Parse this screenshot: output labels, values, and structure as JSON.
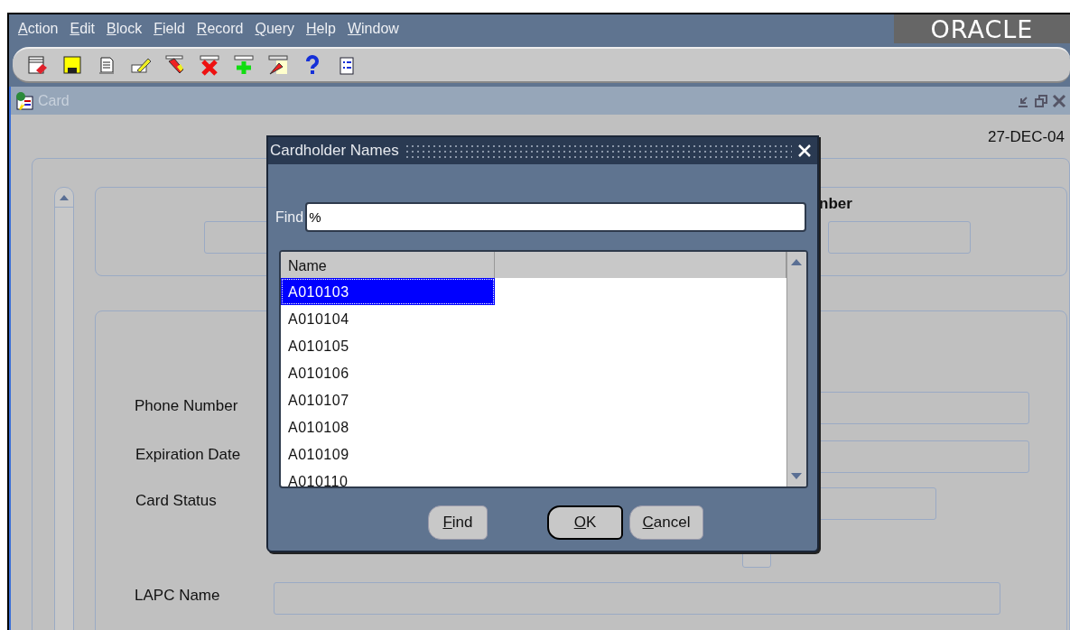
{
  "menu": [
    {
      "label": "Action"
    },
    {
      "label": "Edit"
    },
    {
      "label": "Block"
    },
    {
      "label": "Field"
    },
    {
      "label": "Record"
    },
    {
      "label": "Query"
    },
    {
      "label": "Help"
    },
    {
      "label": "Window"
    }
  ],
  "logo": "ORACLE",
  "window": {
    "title": "Card",
    "date": "27-DEC-04"
  },
  "form": {
    "heading_fragment": "nber",
    "fields": [
      {
        "label": "Phone Number"
      },
      {
        "label": "Expiration Date"
      },
      {
        "label": "Card Status"
      },
      {
        "label": "LAPC Name"
      }
    ],
    "checkbox": {
      "checked": false
    }
  },
  "dialog": {
    "title": "Cardholder Names",
    "find_label": "Find",
    "find_value": "%",
    "columns": [
      "Name"
    ],
    "rows": [
      {
        "name": "A010103",
        "selected": true
      },
      {
        "name": "A010104",
        "selected": false
      },
      {
        "name": "A010105",
        "selected": false
      },
      {
        "name": "A010106",
        "selected": false
      },
      {
        "name": "A010107",
        "selected": false
      },
      {
        "name": "A010108",
        "selected": false
      },
      {
        "name": "A010109",
        "selected": false
      },
      {
        "name": "A010110",
        "selected": false
      }
    ],
    "buttons": [
      {
        "label": "Find",
        "default": false
      },
      {
        "label": "OK",
        "default": true
      },
      {
        "label": "Cancel",
        "default": false
      }
    ]
  }
}
